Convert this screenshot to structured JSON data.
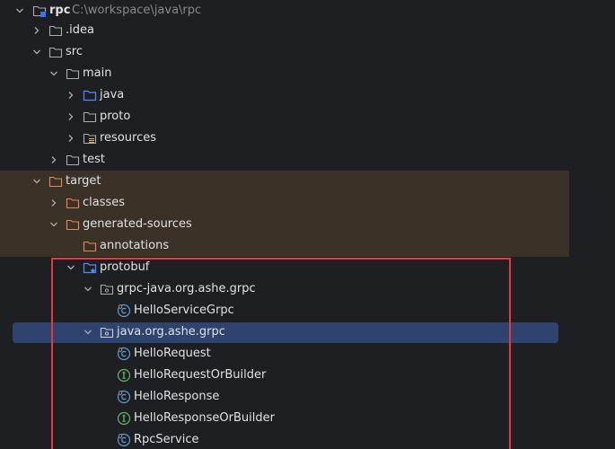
{
  "colors": {
    "background": "#1e1f22",
    "excluded_band": "#3a3127",
    "selection": "#2e436e",
    "highlight_border": "#e5373d",
    "class_icon": "#5b9bd5",
    "interface_icon": "#5fb865"
  },
  "tree": [
    {
      "label": "rpc",
      "path": "C:\\workspace\\java\\rpc",
      "icon": "project-folder-icon",
      "expanded": true
    },
    {
      "label": ".idea",
      "icon": "folder-icon",
      "expanded": false
    },
    {
      "label": "src",
      "icon": "folder-icon",
      "expanded": true
    },
    {
      "label": "main",
      "icon": "folder-icon",
      "expanded": true
    },
    {
      "label": "java",
      "icon": "source-root-folder-icon",
      "expanded": false
    },
    {
      "label": "proto",
      "icon": "folder-icon",
      "expanded": false
    },
    {
      "label": "resources",
      "icon": "resources-folder-icon",
      "expanded": false
    },
    {
      "label": "test",
      "icon": "folder-icon",
      "expanded": false
    },
    {
      "label": "target",
      "icon": "excluded-folder-icon",
      "expanded": true
    },
    {
      "label": "classes",
      "icon": "excluded-folder-icon",
      "expanded": false
    },
    {
      "label": "generated-sources",
      "icon": "excluded-folder-icon",
      "expanded": true
    },
    {
      "label": "annotations",
      "icon": "excluded-folder-icon"
    },
    {
      "label": "protobuf",
      "icon": "generated-source-folder-icon",
      "expanded": true
    },
    {
      "label": "grpc-java.org.ashe.grpc",
      "icon": "package-icon",
      "expanded": true
    },
    {
      "label": "HelloServiceGrpc",
      "icon": "class-icon"
    },
    {
      "label": "java.org.ashe.grpc",
      "icon": "package-icon",
      "expanded": true
    },
    {
      "label": "HelloRequest",
      "icon": "class-icon"
    },
    {
      "label": "HelloRequestOrBuilder",
      "icon": "interface-icon"
    },
    {
      "label": "HelloResponse",
      "icon": "class-icon"
    },
    {
      "label": "HelloResponseOrBuilder",
      "icon": "interface-icon"
    },
    {
      "label": "RpcService",
      "icon": "class-icon"
    }
  ]
}
